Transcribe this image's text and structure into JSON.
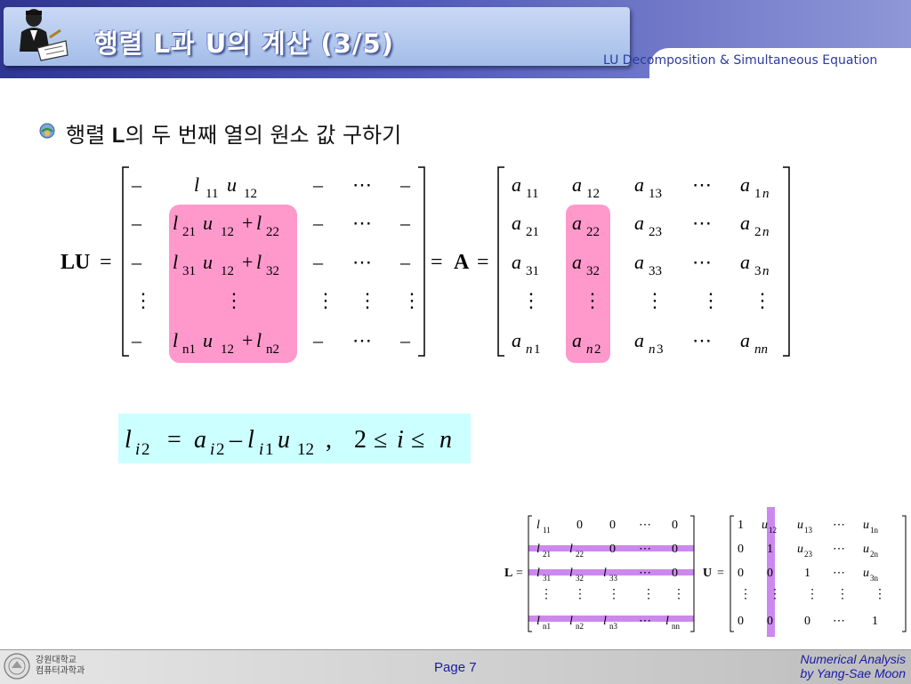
{
  "header": {
    "title": "행렬 L과 U의 계산 (3/5)",
    "subtitle": "LU Decomposition & Simultaneous Equation"
  },
  "bullet": {
    "pre": "행렬 ",
    "bold": "L",
    "post": "의 두 번째 열의 원소 값 구하기"
  },
  "footer": {
    "university_line1": "강원대학교",
    "university_line2": "컴퓨터과학과",
    "page": "Page 7",
    "credit_line1": "Numerical Analysis",
    "credit_line2": "by Yang-Sae Moon"
  },
  "colors": {
    "pink_highlight": "#ff99cc",
    "formula_bg": "#ccffff",
    "purple_highlight": "#cc88ee",
    "subtitle_blue": "#2b3aa0",
    "footer_text": "#1a1aa8"
  },
  "icons": [
    "presenter-icon",
    "bullet-ball-icon",
    "university-seal-icon"
  ]
}
